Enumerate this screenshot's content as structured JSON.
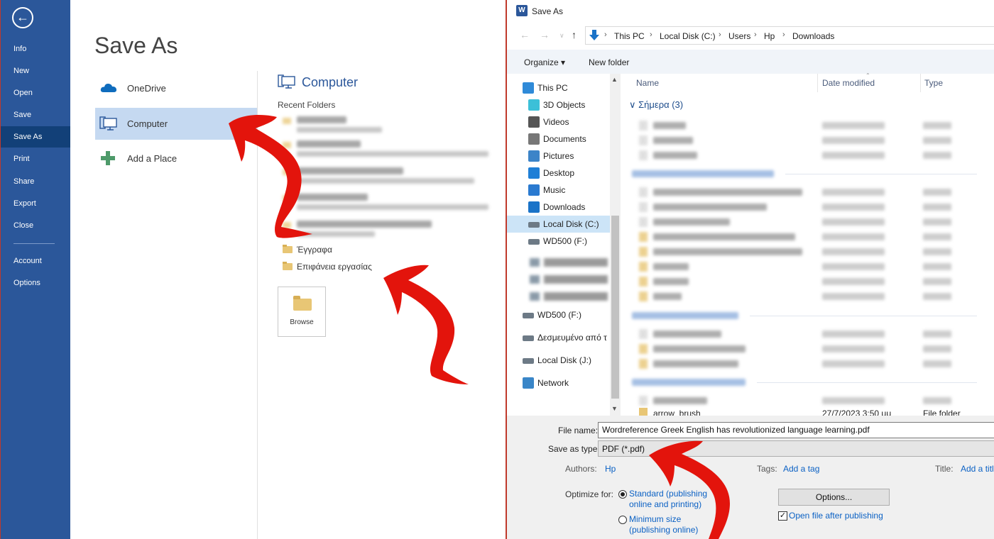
{
  "backstage": {
    "nav": [
      {
        "label": "Info",
        "name": "nav-info"
      },
      {
        "label": "New",
        "name": "nav-new"
      },
      {
        "label": "Open",
        "name": "nav-open"
      },
      {
        "label": "Save",
        "name": "nav-save"
      },
      {
        "label": "Save As",
        "name": "nav-save-as",
        "active": true
      },
      {
        "label": "Print",
        "name": "nav-print"
      },
      {
        "label": "Share",
        "name": "nav-share"
      },
      {
        "label": "Export",
        "name": "nav-export"
      },
      {
        "label": "Close",
        "name": "nav-close"
      },
      {
        "label": "Account",
        "name": "nav-account"
      },
      {
        "label": "Options",
        "name": "nav-options"
      }
    ],
    "title": "Save As",
    "locations": {
      "onedrive": "OneDrive",
      "computer": "Computer",
      "add_place": "Add a Place"
    },
    "computer_heading": "Computer",
    "recent_folders_label": "Recent Folders",
    "recent_visible": [
      "Έγγραφα",
      "Επιφάνεια εργασίας"
    ],
    "browse_label": "Browse"
  },
  "dialog": {
    "title": "Save As",
    "breadcrumb": [
      "This PC",
      "Local Disk (C:)",
      "Users",
      "Hp",
      "Downloads"
    ],
    "toolbar": {
      "organize": "Organize",
      "new_folder": "New folder"
    },
    "tree": [
      {
        "label": "This PC",
        "icon": "pc-icon"
      },
      {
        "label": "3D Objects",
        "icon": "cube-icon"
      },
      {
        "label": "Videos",
        "icon": "video-icon"
      },
      {
        "label": "Documents",
        "icon": "document-icon"
      },
      {
        "label": "Pictures",
        "icon": "pictures-icon"
      },
      {
        "label": "Desktop",
        "icon": "desktop-icon"
      },
      {
        "label": "Music",
        "icon": "music-icon"
      },
      {
        "label": "Downloads",
        "icon": "download-icon"
      },
      {
        "label": "Local Disk (C:)",
        "icon": "drive-icon",
        "selected": true
      },
      {
        "label": "WD500 (F:)",
        "icon": "drive-icon"
      },
      {
        "label": "WD500 (F:)",
        "icon": "drive-icon"
      },
      {
        "label": "Δεσμευμένο από τ",
        "icon": "drive-icon"
      },
      {
        "label": "Local Disk (J:)",
        "icon": "drive-icon"
      },
      {
        "label": "Network",
        "icon": "network-icon"
      }
    ],
    "columns": {
      "name": "Name",
      "date": "Date modified",
      "type": "Type"
    },
    "group_today": "Σήμερα (3)",
    "last_row": {
      "name": "arrow_brush",
      "date": "27/7/2023 3:50 μμ",
      "type": "File folder"
    },
    "file_name_label": "File name:",
    "file_name": "Wordreference Greek English has revolutionized language learning.pdf",
    "save_type_label": "Save as type:",
    "save_type": "PDF (*.pdf)",
    "authors_label": "Authors:",
    "authors_value": "Hp",
    "tags_label": "Tags:",
    "tags_value": "Add a tag",
    "title_label": "Title:",
    "title_value": "Add a title",
    "optimize_label": "Optimize for:",
    "opt_standard": "Standard (publishing online and printing)",
    "opt_minimum": "Minimum size (publishing online)",
    "options_button": "Options...",
    "open_after": "Open file after publishing"
  },
  "colors": {
    "word_blue": "#2b579a",
    "word_nav_active": "#124078",
    "selection": "#c5d9f1",
    "arrow_red": "#e3140c"
  }
}
